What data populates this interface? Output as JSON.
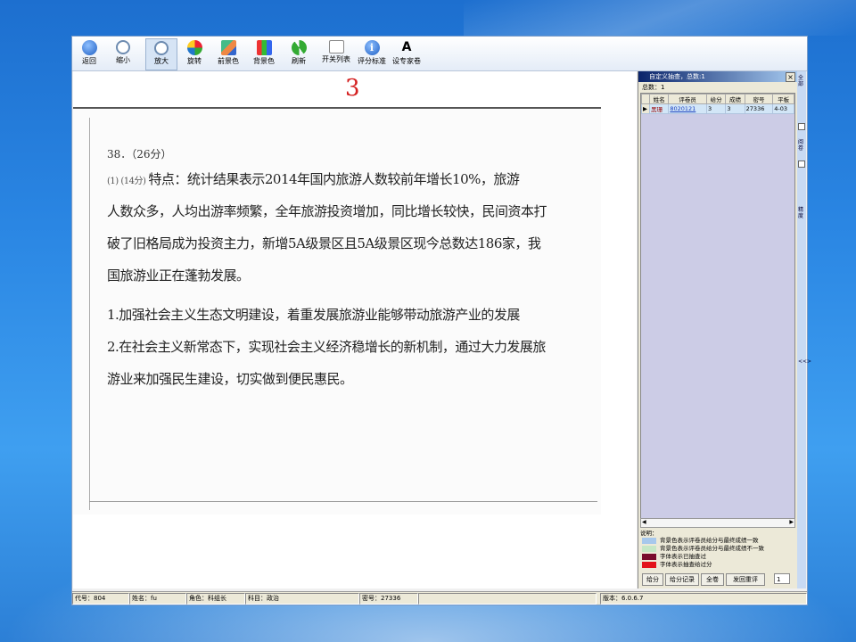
{
  "toolbar": {
    "buttons": [
      {
        "label": "返回",
        "icon": "back-arrow-icon"
      },
      {
        "label": "缩小",
        "icon": "zoom-out-icon"
      },
      {
        "label": "放大",
        "icon": "zoom-in-icon"
      },
      {
        "label": "旋转",
        "icon": "rotate-icon"
      },
      {
        "label": "前景色",
        "icon": "foreground-color-icon"
      },
      {
        "label": "背景色",
        "icon": "background-color-icon"
      },
      {
        "label": "刷新",
        "icon": "refresh-icon"
      },
      {
        "label": "开关列表",
        "icon": "list-toggle-icon"
      },
      {
        "label": "评分标准",
        "icon": "info-icon"
      },
      {
        "label": "设专家卷",
        "icon": "font-a-icon"
      }
    ]
  },
  "document": {
    "page_number": "3",
    "question_header": "38．（26分）",
    "answer_lines": [
      {
        "prefix": "(1) (14分)",
        "text": "特点：统计结果表示2014年国内旅游人数较前年增长10%，旅游"
      },
      {
        "prefix": "",
        "text": "人数众多，人均出游率频繁，全年旅游投资增加，同比增长较快，民间资本打"
      },
      {
        "prefix": "",
        "text": "破了旧格局成为投资主力，新增5A级景区且5A级景区现今总数达186家，我"
      },
      {
        "prefix": "",
        "text": "国旅游业正在蓬勃发展。"
      },
      {
        "prefix": "",
        "text": "1.加强社会主义生态文明建设，着重发展旅游业能够带动旅游产业的发展"
      },
      {
        "prefix": "",
        "text": "2.在社会主义新常态下，实现社会主义经济稳增长的新机制，通过大力发展旅"
      },
      {
        "prefix": "",
        "text": "游业来加强民生建设，切实做到便民惠民。"
      }
    ]
  },
  "side_panel": {
    "title": "自定义抽查，总数:1",
    "total_label": "总数：1",
    "columns": [
      "姓名",
      "评卷员",
      "给分",
      "成绩",
      "密号",
      "平板"
    ],
    "rows": [
      {
        "name": "黑珊",
        "marker": "8020121",
        "given": "3",
        "score": "3",
        "secret": "27336",
        "pad": "4-03"
      }
    ],
    "legend_title": "说明：",
    "legend": [
      {
        "color": "#a7c8ec",
        "text": "背景色表示评卷员给分与最终成绩一致"
      },
      {
        "color": "#c6e7c6",
        "text": "背景色表示评卷员给分与最终成绩不一致"
      },
      {
        "color": "#7a0c2e",
        "text": "字体表示已抽查过"
      },
      {
        "color": "#e3131b",
        "text": "字体表示抽查给过分"
      }
    ],
    "buttons": [
      "给分",
      "给分记录",
      "全卷",
      "发回重评"
    ],
    "page_input_value": "1"
  },
  "right_strip": {
    "labels": [
      "全部",
      "阅卷",
      "精度"
    ],
    "arrow": "<<>"
  },
  "status_bar": {
    "code": "代号：804",
    "name": "姓名：fu",
    "role": "角色：科组长",
    "subject": "科目：政治",
    "secret_no": "密号：27336",
    "version": "版本：6.0.6.7"
  }
}
